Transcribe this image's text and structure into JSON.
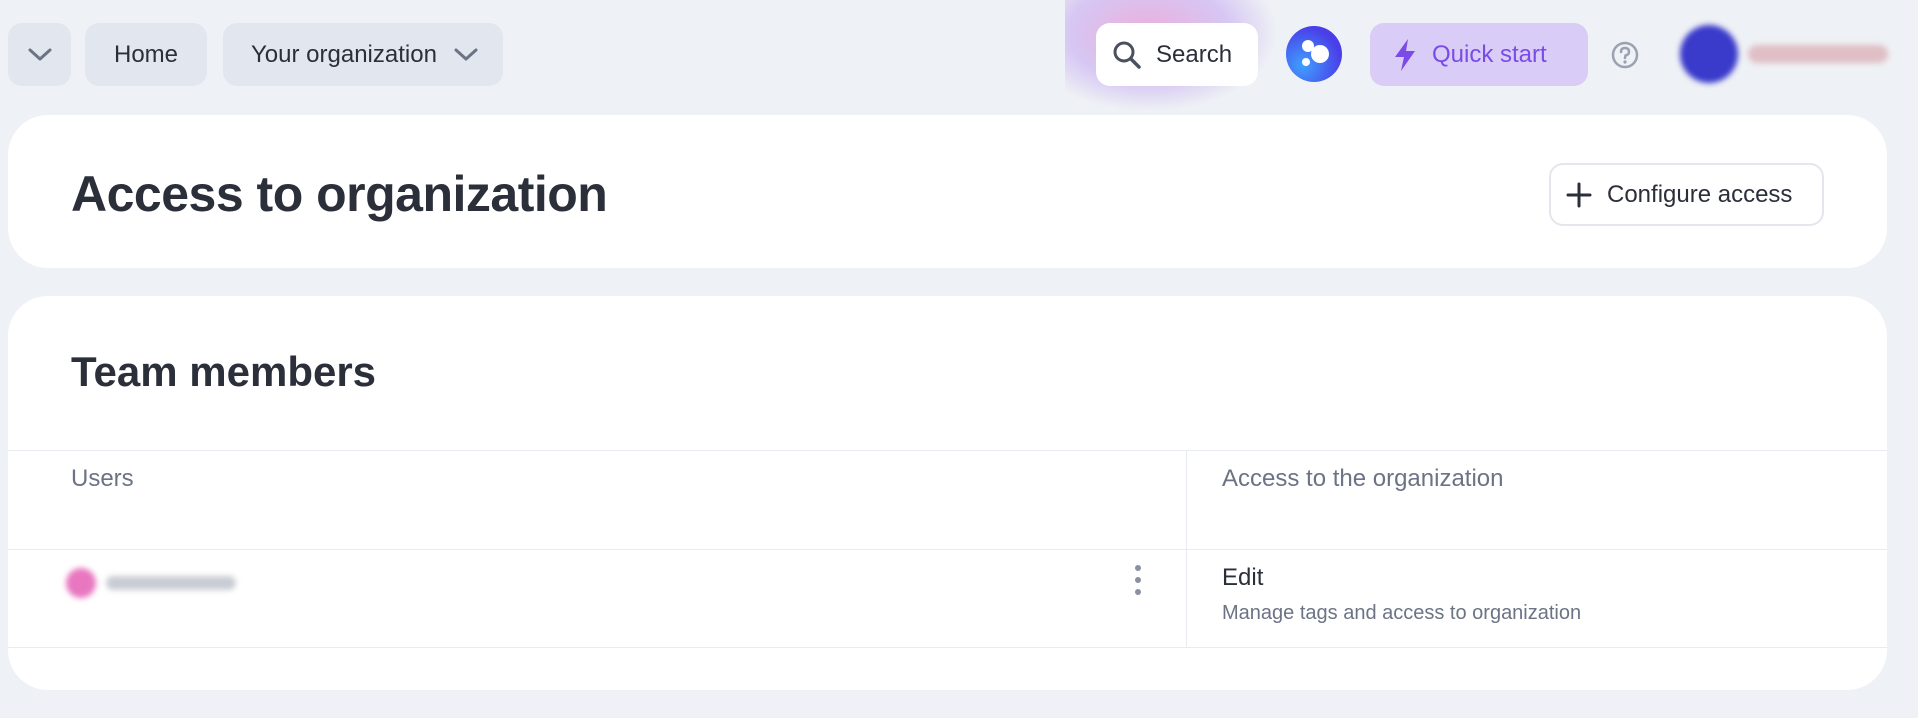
{
  "topbar": {
    "home_label": "Home",
    "org_label": "Your organization",
    "search_label": "Search",
    "quick_start_label": "Quick start"
  },
  "header": {
    "title": "Access to organization",
    "configure_label": "Configure access"
  },
  "team": {
    "title": "Team members",
    "columns": [
      "Users",
      "Access to the organization"
    ],
    "rows": [
      {
        "access_title": "Edit",
        "access_desc": "Manage tags and access to organization"
      }
    ]
  },
  "colors": {
    "background": "#eef1f5",
    "card": "#ffffff",
    "quick_start_bg": "#d9ccf7",
    "quick_start_text": "#7a4be6",
    "assistant": "#4a3ee8"
  },
  "icons": [
    "chevron-down-icon",
    "search-icon",
    "assistant-icon",
    "lightning-icon",
    "help-icon",
    "plus-icon",
    "more-vertical-icon"
  ]
}
